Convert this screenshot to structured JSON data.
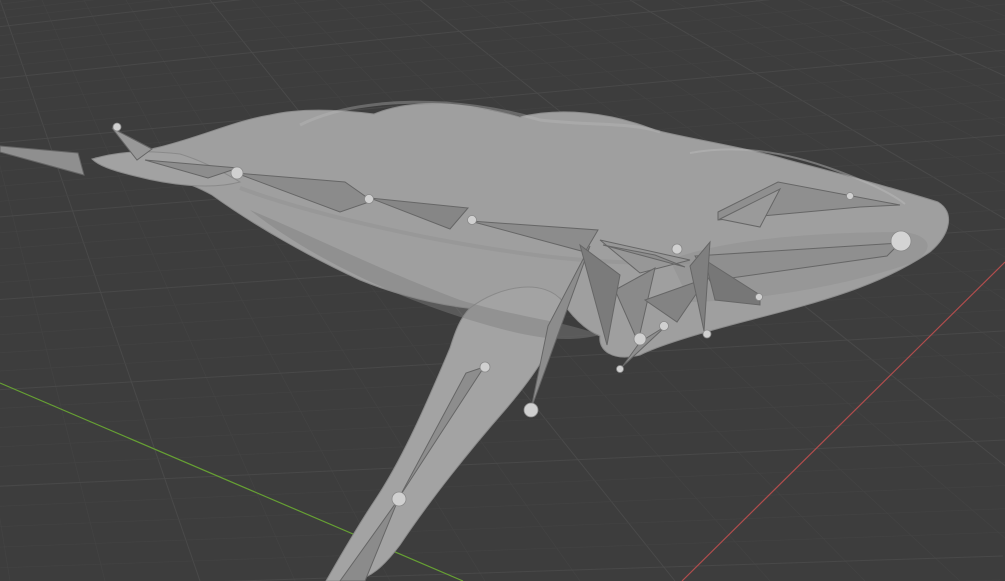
{
  "app": {
    "title": ""
  },
  "viewport": {
    "mode": "3d-viewport",
    "background_color": "#3d3d3d",
    "grid_color": "#4b4b4b",
    "grid_minor_color": "#444444",
    "x_axis_color": "#b14d4d",
    "y_axis_color": "#66a033",
    "mesh_color": "#9f9f9f",
    "mesh_shadow_color": "#777777",
    "armature_color": "#8b8b8b",
    "armature_dark_color": "#666666",
    "joint_color": "#d0d0d0"
  },
  "scene": {
    "object": "whale-mesh",
    "rig": "armature",
    "icons": {
      "joints": "bone-joint-icon"
    }
  }
}
